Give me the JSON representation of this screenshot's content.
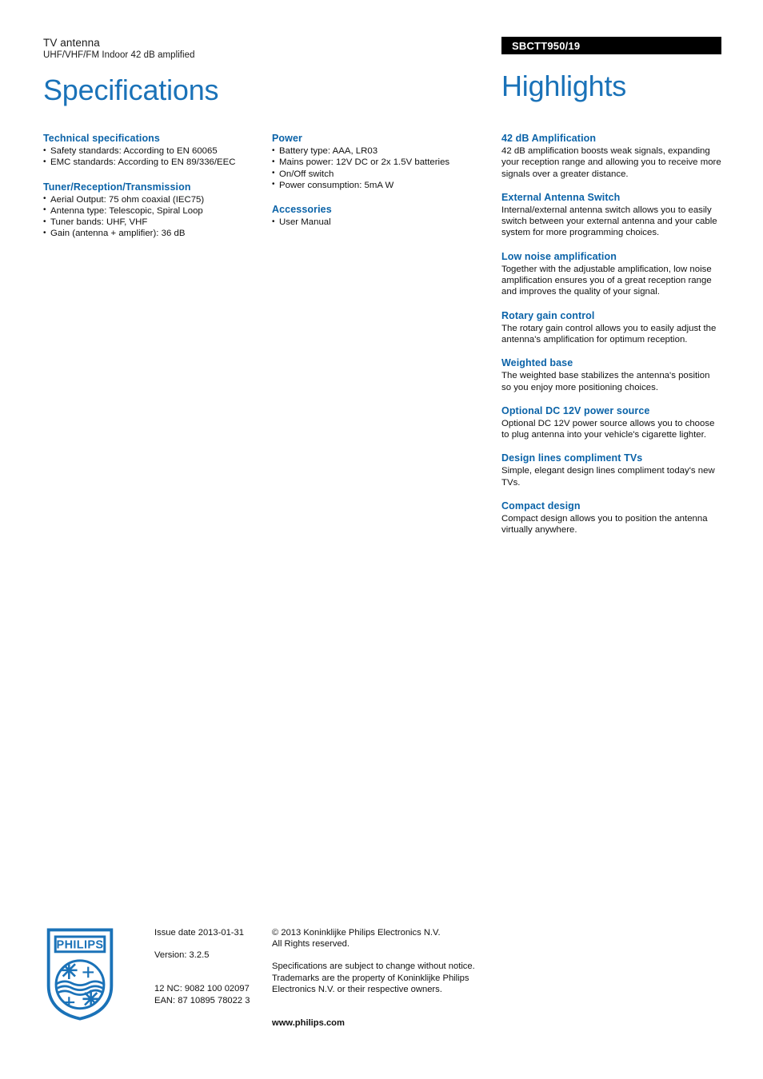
{
  "header": {
    "product_category": "TV antenna",
    "product_subtitle": "UHF/VHF/FM Indoor 42 dB amplified",
    "specifications_title": "Specifications",
    "highlights_title": "Highlights",
    "product_code": "SBCTT950/19"
  },
  "colors": {
    "title_blue": "#1a72b8",
    "heading_blue": "#0b63a8",
    "banner_black": "#000000",
    "logo_blue": "#1a72b8"
  },
  "specifications": {
    "column_1": [
      {
        "title": "Technical specifications",
        "items": [
          "Safety standards: According to EN 60065",
          "EMC standards: According to EN 89/336/EEC"
        ]
      },
      {
        "title": "Tuner/Reception/Transmission",
        "items": [
          "Aerial Output: 75 ohm coaxial (IEC75)",
          "Antenna type: Telescopic, Spiral Loop",
          "Tuner bands: UHF, VHF",
          "Gain (antenna + amplifier): 36 dB"
        ]
      }
    ],
    "column_2": [
      {
        "title": "Power",
        "items": [
          "Battery type: AAA, LR03",
          "Mains power: 12V DC or 2x 1.5V batteries",
          "On/Off switch",
          "Power consumption: 5mA W"
        ]
      },
      {
        "title": "Accessories",
        "items": [
          "User Manual"
        ]
      }
    ]
  },
  "highlights": [
    {
      "title": "42 dB Amplification",
      "body": "42 dB amplification boosts weak signals, expanding your reception range and allowing you to receive more signals over a greater distance."
    },
    {
      "title": "External Antenna Switch",
      "body": "Internal/external antenna switch allows you to easily switch between your external antenna and your cable system for more programming choices."
    },
    {
      "title": "Low noise amplification",
      "body": "Together with the adjustable amplification, low noise amplification ensures you of a great reception range and improves the quality of your signal."
    },
    {
      "title": "Rotary gain control",
      "body": "The rotary gain control allows you to easily adjust the antenna's amplification for optimum reception."
    },
    {
      "title": "Weighted base",
      "body": "The weighted base stabilizes the antenna's position so you enjoy more positioning choices."
    },
    {
      "title": "Optional DC 12V power source",
      "body": "Optional DC 12V power source allows you to choose to plug antenna into your vehicle's cigarette lighter."
    },
    {
      "title": "Design lines compliment TVs",
      "body": "Simple, elegant design lines compliment today's new TVs."
    },
    {
      "title": "Compact design",
      "body": "Compact design allows you to position the antenna virtually anywhere."
    }
  ],
  "footer": {
    "logo_wordmark": "PHILIPS",
    "issue_date": "Issue date 2013-01-31",
    "version": "Version: 3.2.5",
    "twelve_nc": "12 NC: 9082 100 02097",
    "ean": "EAN: 87 10895 78022 3",
    "copyright_line_1": "© 2013 Koninklijke Philips Electronics N.V.",
    "copyright_line_2": "All Rights reserved.",
    "disclaimer_line_1": "Specifications are subject to change without notice.",
    "disclaimer_line_2": "Trademarks are the property of Koninklijke Philips",
    "disclaimer_line_3": "Electronics N.V. or their respective owners.",
    "website": "www.philips.com"
  }
}
